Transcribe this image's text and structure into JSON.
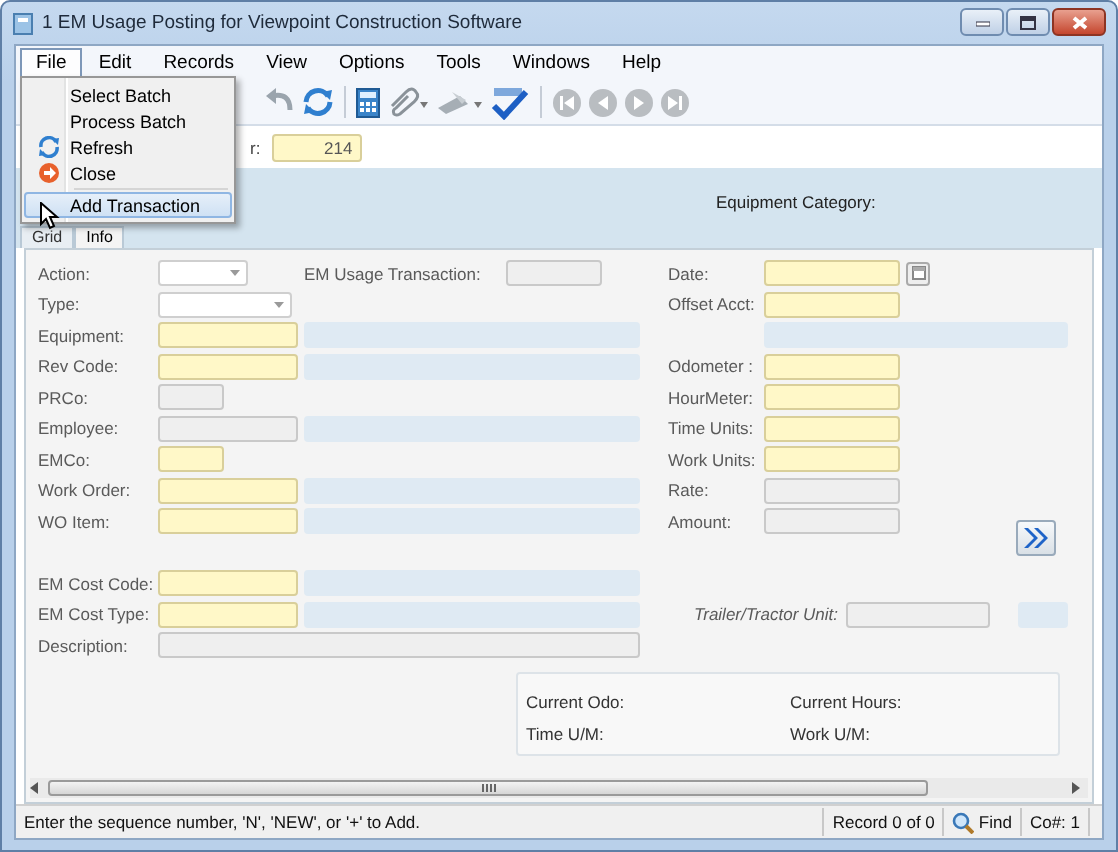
{
  "window": {
    "title": "1 EM Usage Posting for Viewpoint Construction Software"
  },
  "menu_bar": [
    {
      "label": "File",
      "open": true
    },
    {
      "label": "Edit",
      "open": false
    },
    {
      "label": "Records",
      "open": false
    },
    {
      "label": "View",
      "open": false
    },
    {
      "label": "Options",
      "open": false
    },
    {
      "label": "Tools",
      "open": false
    },
    {
      "label": "Windows",
      "open": false
    },
    {
      "label": "Help",
      "open": false
    }
  ],
  "file_menu": {
    "items": [
      {
        "label": "Select Batch",
        "selected": false
      },
      {
        "label": "Process Batch",
        "selected": false
      },
      {
        "label": "Refresh",
        "selected": false
      },
      {
        "label": "Close",
        "selected": false
      },
      {
        "label": "Add Transaction",
        "selected": true
      }
    ]
  },
  "header": {
    "label": "r:",
    "value": "214"
  },
  "equipment_category": {
    "label": "Equipment Category:"
  },
  "tabs": [
    {
      "label": "Grid",
      "selected": false
    },
    {
      "label": "Info",
      "selected": true
    }
  ],
  "form": {
    "top_rows": [
      {
        "label": "Action:",
        "kind": "dropdown",
        "description": false
      },
      {
        "label": "Type:",
        "kind": "dropdown",
        "description": false
      },
      {
        "label": "Equipment:",
        "kind": "required",
        "description": true
      },
      {
        "label": "Rev Code:",
        "kind": "required",
        "description": true
      },
      {
        "label": "PRCo:",
        "kind": "readonly",
        "description": false
      },
      {
        "label": "Employee:",
        "kind": "readonly",
        "description": true
      },
      {
        "label": "EMCo:",
        "kind": "required",
        "description": false
      },
      {
        "label": "Work Order:",
        "kind": "required",
        "description": true
      },
      {
        "label": "WO Item:",
        "kind": "required",
        "description": true
      }
    ],
    "transaction": {
      "label": "EM Usage Transaction:",
      "kind": "readonly"
    },
    "right_rows": [
      {
        "label": "Date:",
        "kind": "required",
        "calendar": true
      },
      {
        "label": "Offset Acct:",
        "kind": "required"
      },
      {
        "kind": "description"
      },
      {
        "label": "Odometer :",
        "kind": "required"
      },
      {
        "label": "HourMeter:",
        "kind": "required"
      },
      {
        "label": "Time Units:",
        "kind": "required"
      },
      {
        "label": "Work Units:",
        "kind": "required"
      },
      {
        "label": "Rate:",
        "kind": "readonly"
      },
      {
        "label": "Amount:",
        "kind": "readonly"
      }
    ],
    "bottom_rows": [
      {
        "label": "EM Cost Code:",
        "kind": "required",
        "description": true
      },
      {
        "label": "EM Cost Type:",
        "kind": "required",
        "description": true
      },
      {
        "label": "Description:",
        "kind": "readonly",
        "description": false
      }
    ],
    "trailer": {
      "label": "Trailer/Tractor Unit:",
      "kind": "readonly",
      "description": true
    }
  },
  "summary": [
    {
      "label": "Current Odo:"
    },
    {
      "label": "Current Hours:"
    },
    {
      "label": "Time U/M:"
    },
    {
      "label": "Work U/M:"
    }
  ],
  "status_bar": {
    "message": "Enter the sequence number, 'N', 'NEW',  or '+' to Add.",
    "record": "Record 0 of 0",
    "find": "Find",
    "company": "Co#: 1"
  }
}
